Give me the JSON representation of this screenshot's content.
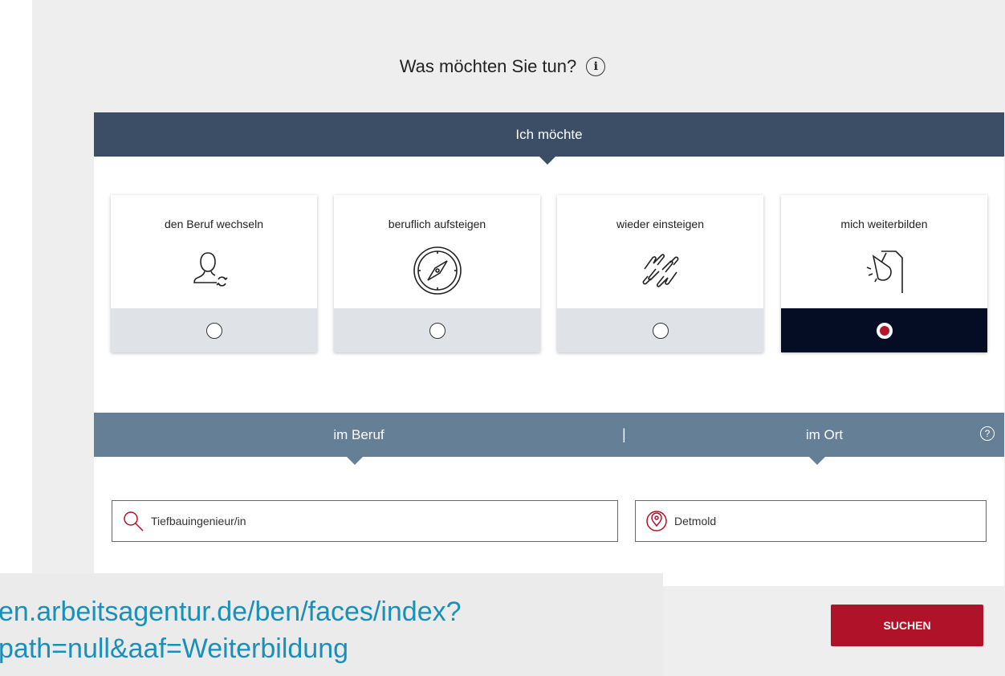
{
  "title": "Was möchten Sie tun?",
  "title_icon": "info-icon",
  "choice_header": "Ich möchte",
  "options": [
    {
      "label": "den Beruf wechseln",
      "icon": "person-swap-icon",
      "selected": false
    },
    {
      "label": "beruflich aufsteigen",
      "icon": "compass-icon",
      "selected": false
    },
    {
      "label": "wieder einsteigen",
      "icon": "hands-icon",
      "selected": false
    },
    {
      "label": "mich weiterbilden",
      "icon": "lamp-icon",
      "selected": true
    }
  ],
  "search": {
    "tab_beruf": "im Beruf",
    "divider": "|",
    "tab_ort": "im Ort",
    "help_icon": "question-icon",
    "beruf_value": "Tiefbauingenieur/in",
    "ort_value": "Detmold"
  },
  "submit_label": "SUCHEN",
  "url_overlay": {
    "line1": "en.arbeitsagentur.de/ben/faces/index?",
    "line2": "path=null&aaf=Weiterbildung"
  },
  "colors": {
    "header_dark": "#3b4e65",
    "header_mid": "#657f96",
    "accent": "#b0122a",
    "selected_bg": "#050d24"
  }
}
